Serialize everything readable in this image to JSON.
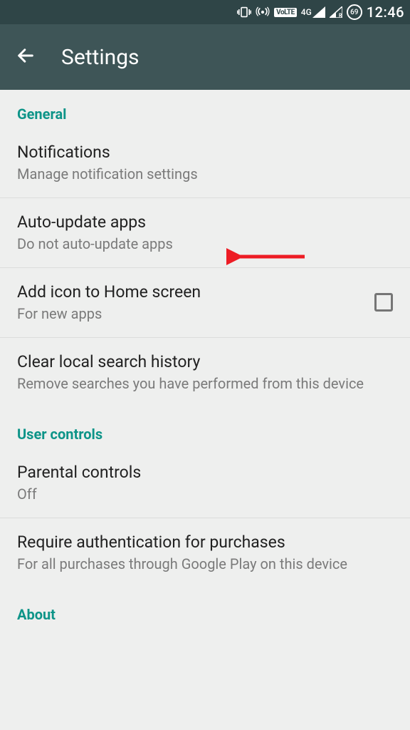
{
  "status_bar": {
    "battery_pct": "69",
    "clock": "12:46",
    "volte": "VoLTE",
    "network": "4G"
  },
  "app_bar": {
    "title": "Settings"
  },
  "sections": {
    "general": {
      "header": "General",
      "notifications": {
        "title": "Notifications",
        "sub": "Manage notification settings"
      },
      "auto_update": {
        "title": "Auto-update apps",
        "sub": "Do not auto-update apps"
      },
      "add_icon": {
        "title": "Add icon to Home screen",
        "sub": "For new apps"
      },
      "clear_history": {
        "title": "Clear local search history",
        "sub": "Remove searches you have performed from this device"
      }
    },
    "user_controls": {
      "header": "User controls",
      "parental": {
        "title": "Parental controls",
        "sub": "Off"
      },
      "auth": {
        "title": "Require authentication for purchases",
        "sub": "For all purchases through Google Play on this device"
      }
    },
    "about": {
      "header": "About"
    }
  }
}
